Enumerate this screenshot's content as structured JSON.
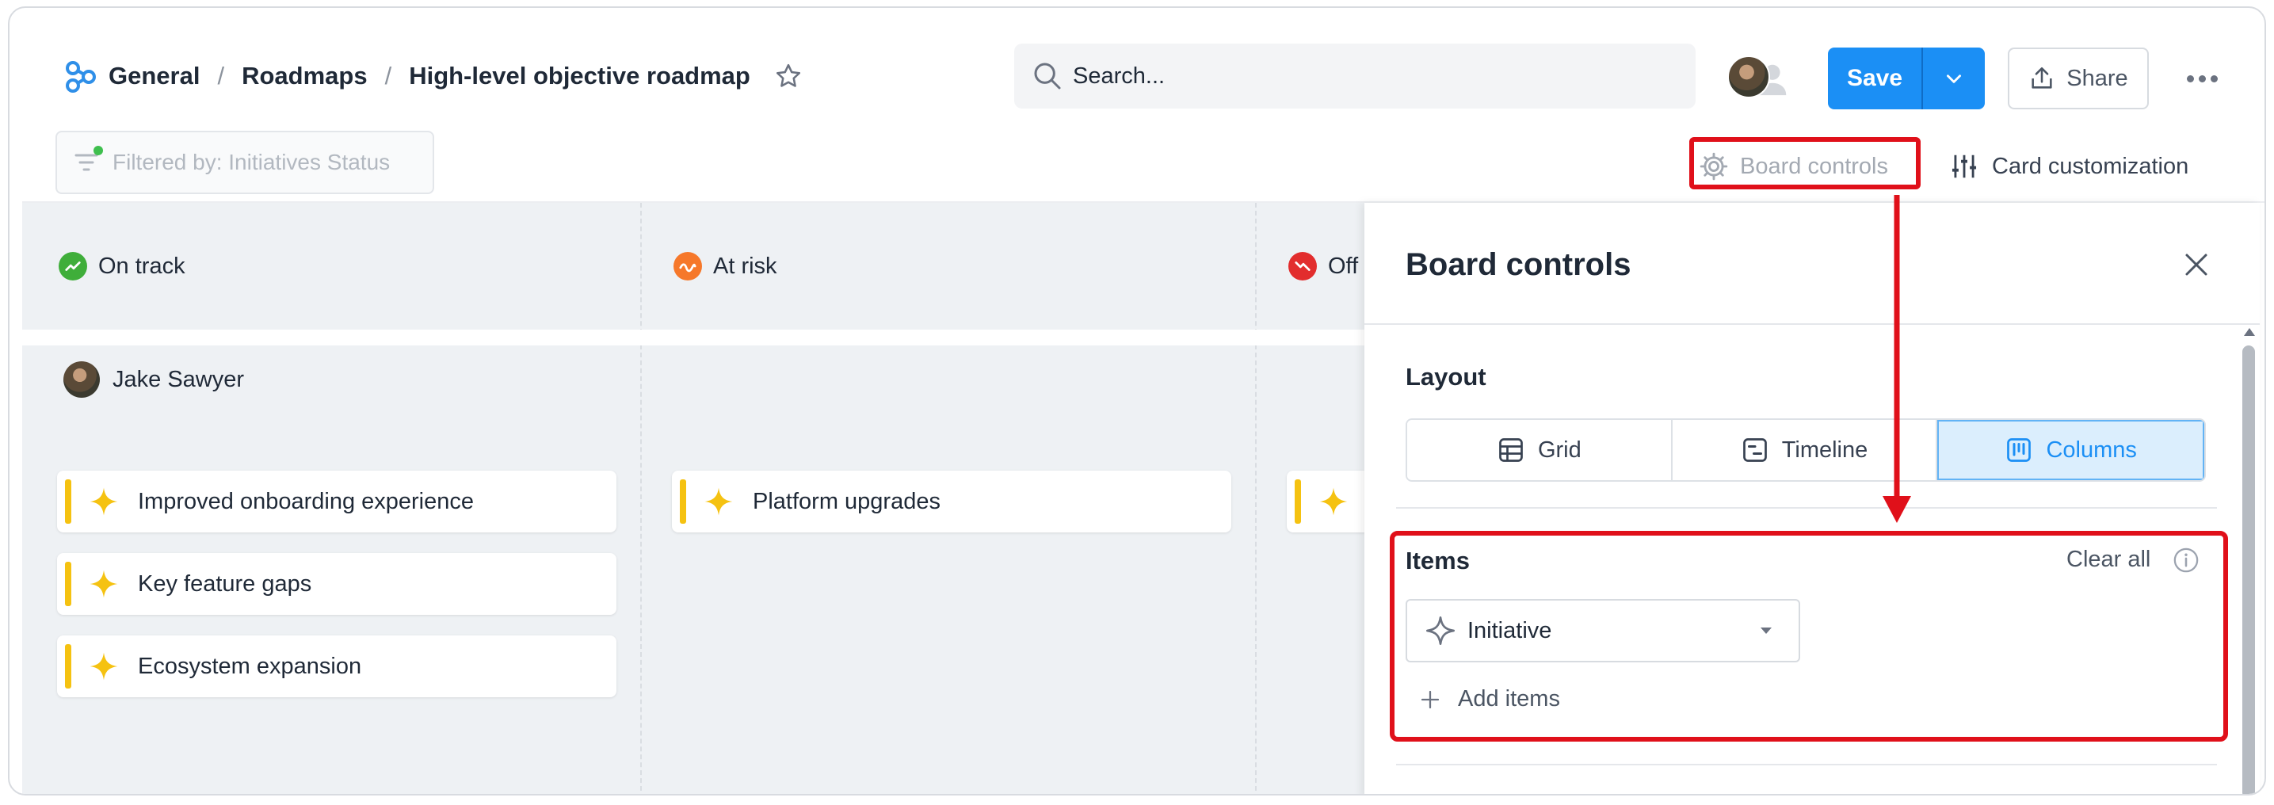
{
  "breadcrumb": [
    "General",
    "Roadmaps",
    "High-level objective roadmap"
  ],
  "breadcrumb_sep": "/",
  "search": {
    "placeholder": "Search..."
  },
  "actions": {
    "save": "Save",
    "share": "Share"
  },
  "toolbar": {
    "filter": "Filtered by: Initiatives Status",
    "board_controls": "Board controls",
    "card_customization": "Card customization"
  },
  "columns": [
    {
      "label": "On track",
      "color": "#3fae3a"
    },
    {
      "label": "At risk",
      "color": "#f6782a"
    },
    {
      "label": "Off",
      "color": "#e22d2d"
    }
  ],
  "swimlane": {
    "owner": "Jake Sawyer"
  },
  "cards": {
    "on_track": [
      "Improved onboarding experience",
      "Key feature gaps",
      "Ecosystem expansion"
    ],
    "at_risk": [
      "Platform upgrades"
    ],
    "off": [
      ""
    ]
  },
  "panel": {
    "title": "Board controls",
    "layout_label": "Layout",
    "layout_options": [
      "Grid",
      "Timeline",
      "Columns"
    ],
    "layout_selected": "Columns",
    "items_label": "Items",
    "clear_all": "Clear all",
    "item_selected": "Initiative",
    "add_items": "Add items"
  },
  "colors": {
    "accent": "#1b8ff5",
    "annotation": "#e0101a",
    "card_bar": "#f5c211"
  }
}
